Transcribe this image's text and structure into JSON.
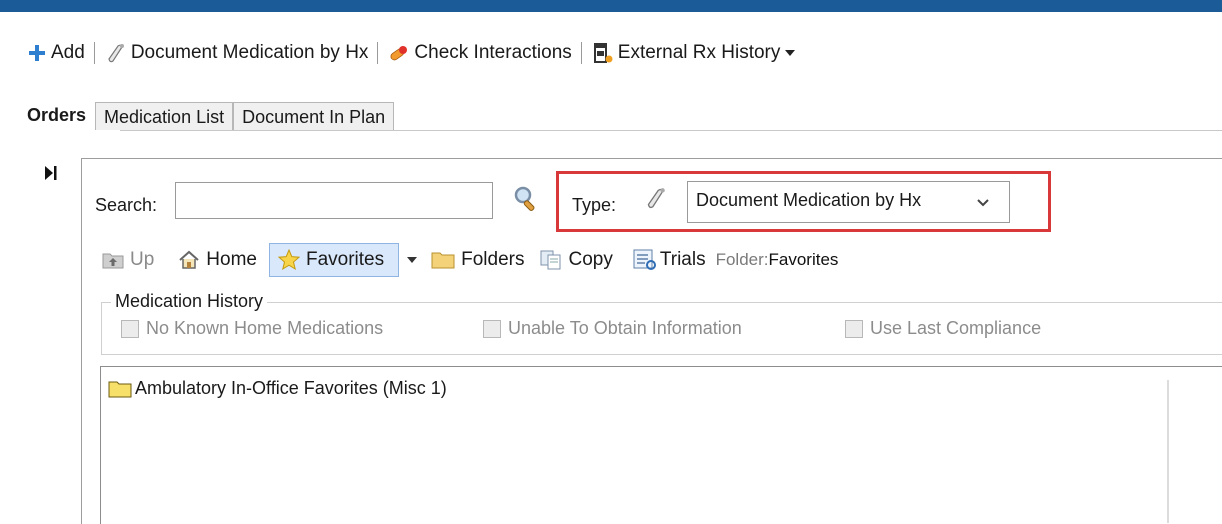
{
  "colors": {
    "title_bar": "#1b5b97",
    "highlight_border": "#d9383a",
    "favorites_bg": "#d9e8fa"
  },
  "toolbar": {
    "add_label": "Add",
    "document_med_label": "Document Medication by Hx",
    "check_interactions_label": "Check Interactions",
    "external_rx_label": "External Rx History"
  },
  "tabs": [
    "Orders",
    "Medication List",
    "Document In Plan"
  ],
  "search": {
    "label": "Search:",
    "value": "",
    "placeholder": ""
  },
  "type_filter": {
    "label": "Type:",
    "selected": "Document Medication by Hx"
  },
  "nav": {
    "up": "Up",
    "home": "Home",
    "favorites": "Favorites",
    "folders": "Folders",
    "copy": "Copy",
    "trials": "Trials",
    "folder_label": "Folder:",
    "folder_value": "Favorites"
  },
  "medication_history": {
    "title": "Medication History",
    "options": [
      "No Known Home Medications",
      "Unable To Obtain Information",
      "Use Last Compliance"
    ]
  },
  "list": {
    "items": [
      "Ambulatory In-Office Favorites (Misc 1)"
    ]
  }
}
